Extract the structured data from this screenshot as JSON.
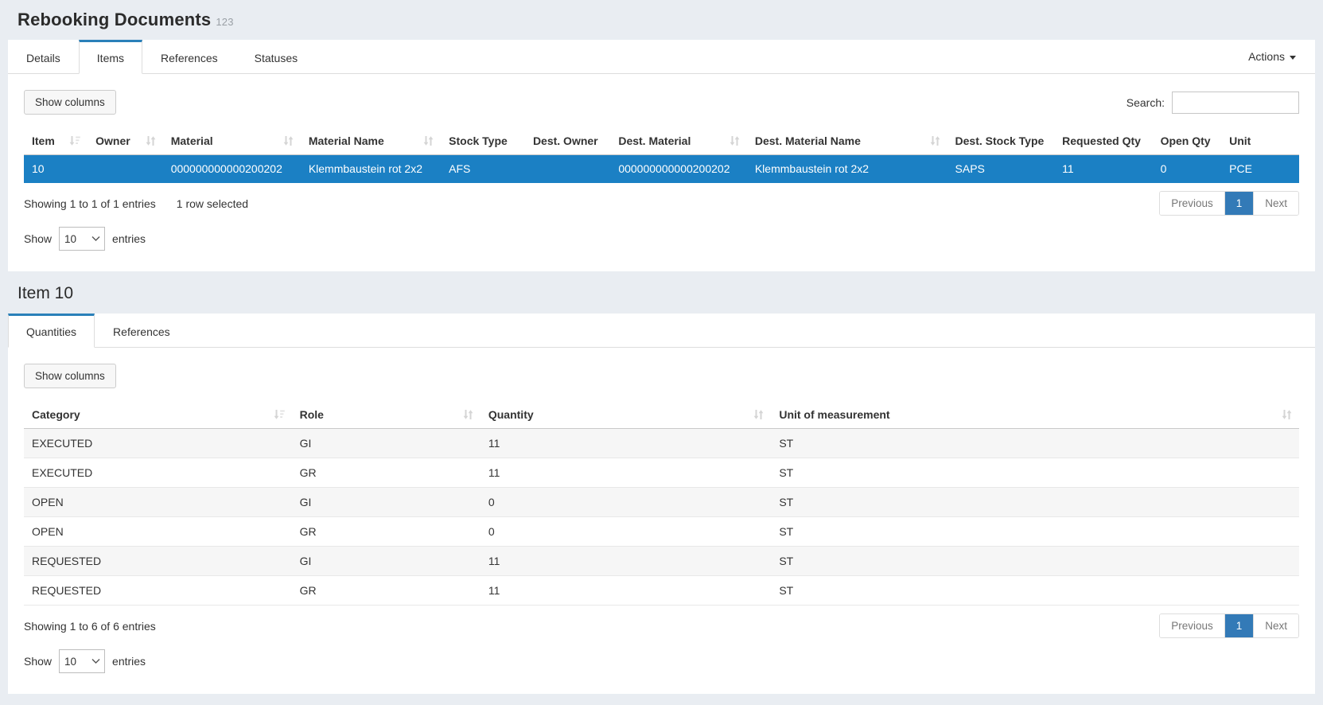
{
  "colors": {
    "page_background": "#e9edf2",
    "accent_tab_blue": "#2a80b9",
    "selected_row_blue": "#1b80c4",
    "pagination_active_blue": "#337ab7"
  },
  "page": {
    "title": "Rebooking Documents",
    "count": "123"
  },
  "items_panel": {
    "tabs": [
      {
        "label": "Details"
      },
      {
        "label": "Items"
      },
      {
        "label": "References"
      },
      {
        "label": "Statuses"
      }
    ],
    "actions_label": "Actions",
    "toolbar": {
      "show_columns": "Show columns",
      "search_label": "Search:",
      "search_value": ""
    },
    "table": {
      "columns": [
        {
          "label": "Item",
          "sort": "asc"
        },
        {
          "label": "Owner",
          "sort": "both"
        },
        {
          "label": "Material",
          "sort": "both"
        },
        {
          "label": "Material Name",
          "sort": "both"
        },
        {
          "label": "Stock Type",
          "sort": "none"
        },
        {
          "label": "Dest. Owner",
          "sort": "none"
        },
        {
          "label": "Dest. Material",
          "sort": "both"
        },
        {
          "label": "Dest. Material Name",
          "sort": "both"
        },
        {
          "label": "Dest. Stock Type",
          "sort": "none"
        },
        {
          "label": "Requested Qty",
          "sort": "none"
        },
        {
          "label": "Open Qty",
          "sort": "none"
        },
        {
          "label": "Unit",
          "sort": "none"
        }
      ],
      "rows": [
        {
          "cells": [
            "10",
            "",
            "000000000000200202",
            "Klemmbaustein rot 2x2",
            "AFS",
            "",
            "000000000000200202",
            "Klemmbaustein rot 2x2",
            "SAPS",
            "11",
            "0",
            "PCE"
          ],
          "selected": true
        }
      ]
    },
    "footer": {
      "showing": "Showing 1 to 1 of 1 entries",
      "selected_info": "1 row selected",
      "previous": "Previous",
      "page": "1",
      "next": "Next"
    },
    "page_size": {
      "show": "Show",
      "value": "10",
      "entries": "entries"
    }
  },
  "item_panel": {
    "title": "Item 10",
    "tabs": [
      {
        "label": "Quantities"
      },
      {
        "label": "References"
      }
    ],
    "toolbar": {
      "show_columns": "Show columns"
    },
    "table": {
      "columns": [
        {
          "label": "Category",
          "sort": "asc"
        },
        {
          "label": "Role",
          "sort": "both"
        },
        {
          "label": "Quantity",
          "sort": "both"
        },
        {
          "label": "Unit of measurement",
          "sort": "both"
        }
      ],
      "rows": [
        {
          "cells": [
            "EXECUTED",
            "GI",
            "11",
            "ST"
          ]
        },
        {
          "cells": [
            "EXECUTED",
            "GR",
            "11",
            "ST"
          ]
        },
        {
          "cells": [
            "OPEN",
            "GI",
            "0",
            "ST"
          ]
        },
        {
          "cells": [
            "OPEN",
            "GR",
            "0",
            "ST"
          ]
        },
        {
          "cells": [
            "REQUESTED",
            "GI",
            "11",
            "ST"
          ]
        },
        {
          "cells": [
            "REQUESTED",
            "GR",
            "11",
            "ST"
          ]
        }
      ]
    },
    "footer": {
      "showing": "Showing 1 to 6 of 6 entries",
      "previous": "Previous",
      "page": "1",
      "next": "Next"
    },
    "page_size": {
      "show": "Show",
      "value": "10",
      "entries": "entries"
    }
  }
}
